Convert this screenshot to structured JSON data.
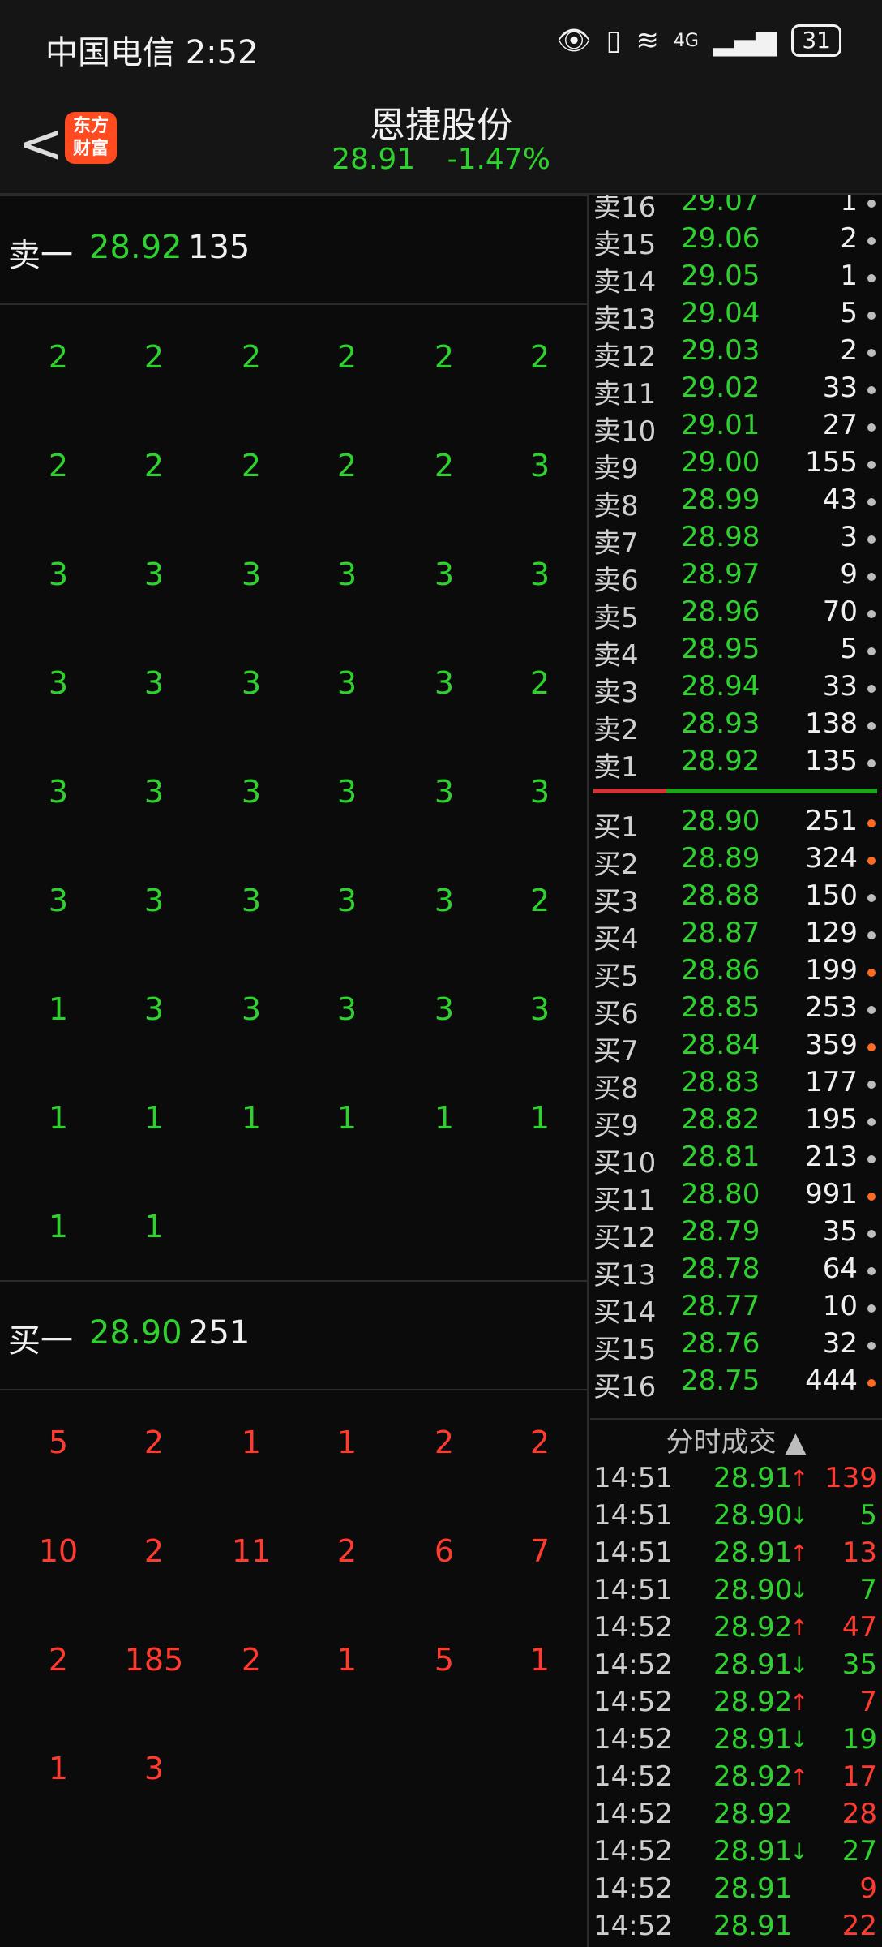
{
  "status": {
    "carrier": "中国电信 2:52",
    "net": "4G",
    "battery": "31"
  },
  "header": {
    "back": "<",
    "logo": "东方财富",
    "title": "恩捷股份",
    "price": "28.91",
    "change": "-1.47%"
  },
  "ask_head": {
    "label": "卖一",
    "price": "28.92",
    "qty": "135"
  },
  "ask_grid": [
    [
      "2",
      "2",
      "2",
      "2",
      "2",
      "2"
    ],
    [
      "2",
      "2",
      "2",
      "2",
      "2",
      "3"
    ],
    [
      "3",
      "3",
      "3",
      "3",
      "3",
      "3"
    ],
    [
      "3",
      "3",
      "3",
      "3",
      "3",
      "2"
    ],
    [
      "3",
      "3",
      "3",
      "3",
      "3",
      "3"
    ],
    [
      "3",
      "3",
      "3",
      "3",
      "3",
      "2"
    ],
    [
      "1",
      "3",
      "3",
      "3",
      "3",
      "3"
    ],
    [
      "1",
      "1",
      "1",
      "1",
      "1",
      "1"
    ],
    [
      "1",
      "1",
      "",
      "",
      "",
      ""
    ]
  ],
  "bid_head": {
    "label": "买一",
    "price": "28.90",
    "qty": "251"
  },
  "bid_grid": [
    [
      "5",
      "2",
      "1",
      "1",
      "2",
      "2"
    ],
    [
      "10",
      "2",
      "11",
      "2",
      "6",
      "7"
    ],
    [
      "2",
      "185",
      "2",
      "1",
      "5",
      "1"
    ],
    [
      "1",
      "3",
      "",
      "",
      "",
      ""
    ]
  ],
  "depth_sell": [
    {
      "label": "卖16",
      "price": "29.07",
      "qty": "1"
    },
    {
      "label": "卖15",
      "price": "29.06",
      "qty": "2"
    },
    {
      "label": "卖14",
      "price": "29.05",
      "qty": "1"
    },
    {
      "label": "卖13",
      "price": "29.04",
      "qty": "5"
    },
    {
      "label": "卖12",
      "price": "29.03",
      "qty": "2"
    },
    {
      "label": "卖11",
      "price": "29.02",
      "qty": "33"
    },
    {
      "label": "卖10",
      "price": "29.01",
      "qty": "27"
    },
    {
      "label": "卖9",
      "price": "29.00",
      "qty": "155"
    },
    {
      "label": "卖8",
      "price": "28.99",
      "qty": "43"
    },
    {
      "label": "卖7",
      "price": "28.98",
      "qty": "3"
    },
    {
      "label": "卖6",
      "price": "28.97",
      "qty": "9"
    },
    {
      "label": "卖5",
      "price": "28.96",
      "qty": "70"
    },
    {
      "label": "卖4",
      "price": "28.95",
      "qty": "5"
    },
    {
      "label": "卖3",
      "price": "28.94",
      "qty": "33"
    },
    {
      "label": "卖2",
      "price": "28.93",
      "qty": "138"
    },
    {
      "label": "卖1",
      "price": "28.92",
      "qty": "135"
    }
  ],
  "depth_buy": [
    {
      "label": "买1",
      "price": "28.90",
      "qty": "251",
      "dot": "orange"
    },
    {
      "label": "买2",
      "price": "28.89",
      "qty": "324",
      "dot": "orange"
    },
    {
      "label": "买3",
      "price": "28.88",
      "qty": "150",
      "dot": "grey"
    },
    {
      "label": "买4",
      "price": "28.87",
      "qty": "129",
      "dot": "grey"
    },
    {
      "label": "买5",
      "price": "28.86",
      "qty": "199",
      "dot": "orange"
    },
    {
      "label": "买6",
      "price": "28.85",
      "qty": "253",
      "dot": "grey"
    },
    {
      "label": "买7",
      "price": "28.84",
      "qty": "359",
      "dot": "orange"
    },
    {
      "label": "买8",
      "price": "28.83",
      "qty": "177",
      "dot": "grey"
    },
    {
      "label": "买9",
      "price": "28.82",
      "qty": "195",
      "dot": "grey"
    },
    {
      "label": "买10",
      "price": "28.81",
      "qty": "213",
      "dot": "grey"
    },
    {
      "label": "买11",
      "price": "28.80",
      "qty": "991",
      "dot": "orange"
    },
    {
      "label": "买12",
      "price": "28.79",
      "qty": "35",
      "dot": "grey"
    },
    {
      "label": "买13",
      "price": "28.78",
      "qty": "64",
      "dot": "grey"
    },
    {
      "label": "买14",
      "price": "28.77",
      "qty": "10",
      "dot": "grey"
    },
    {
      "label": "买15",
      "price": "28.76",
      "qty": "32",
      "dot": "grey"
    },
    {
      "label": "买16",
      "price": "28.75",
      "qty": "444",
      "dot": "orange"
    }
  ],
  "trades_title": "分时成交 ▲",
  "trades": [
    {
      "time": "14:51",
      "price": "28.91",
      "dir": "up",
      "vol": "139"
    },
    {
      "time": "14:51",
      "price": "28.90",
      "dir": "down",
      "vol": "5"
    },
    {
      "time": "14:51",
      "price": "28.91",
      "dir": "up",
      "vol": "13"
    },
    {
      "time": "14:51",
      "price": "28.90",
      "dir": "down",
      "vol": "7"
    },
    {
      "time": "14:52",
      "price": "28.92",
      "dir": "up",
      "vol": "47"
    },
    {
      "time": "14:52",
      "price": "28.91",
      "dir": "down",
      "vol": "35"
    },
    {
      "time": "14:52",
      "price": "28.92",
      "dir": "up",
      "vol": "7"
    },
    {
      "time": "14:52",
      "price": "28.91",
      "dir": "down",
      "vol": "19"
    },
    {
      "time": "14:52",
      "price": "28.92",
      "dir": "up",
      "vol": "17"
    },
    {
      "time": "14:52",
      "price": "28.92",
      "dir": "none",
      "vol": "28"
    },
    {
      "time": "14:52",
      "price": "28.91",
      "dir": "down",
      "vol": "27"
    },
    {
      "time": "14:52",
      "price": "28.91",
      "dir": "none",
      "vol": "9"
    },
    {
      "time": "14:52",
      "price": "28.91",
      "dir": "none",
      "vol": "22"
    }
  ],
  "colors": {
    "up": "#ff3b30",
    "down": "#2fd12f"
  }
}
